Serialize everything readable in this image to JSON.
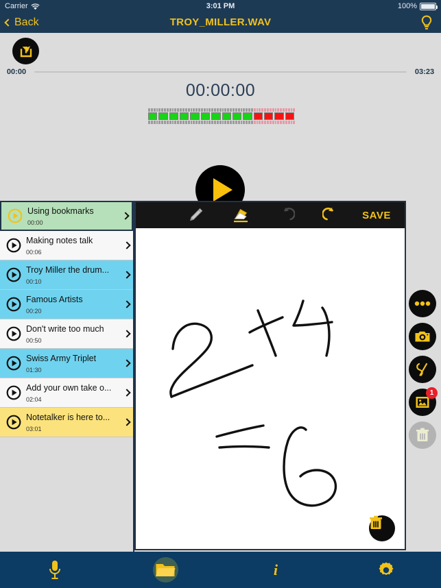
{
  "status_bar": {
    "carrier": "Carrier",
    "wifi_icon": "wifi-icon",
    "time": "3:01 PM",
    "battery_percent": "100%",
    "battery_icon": "battery-icon"
  },
  "nav_bar": {
    "back_label": "Back",
    "back_icon": "chevron-left-icon",
    "title": "TROY_MILLER.WAV",
    "bulb_icon": "lightbulb-icon"
  },
  "player": {
    "share_icon": "share-export-icon",
    "elapsed": "00:00",
    "duration": "03:23",
    "current_time": "00:00:00",
    "play_icon": "play-icon",
    "stop_icon": "stop-icon",
    "bookmark_icon": "bookmark-book-icon",
    "vu_meter": {
      "green_bars": 10,
      "red_bars": 4,
      "green_color": "#18d318",
      "red_color": "#f51414"
    }
  },
  "bookmarks": [
    {
      "title": "Using bookmarks",
      "time": "00:00",
      "color": "#b6e0b9",
      "selected": true,
      "icon": "play-circle-icon"
    },
    {
      "title": "Making notes talk",
      "time": "00:06",
      "color": "#f7f7f7",
      "selected": false,
      "icon": "play-circle-icon"
    },
    {
      "title": "Troy Miller the drum...",
      "time": "00:10",
      "color": "#6fd3ef",
      "selected": false,
      "icon": "play-circle-icon"
    },
    {
      "title": "Famous Artists",
      "time": "00:20",
      "color": "#6fd3ef",
      "selected": false,
      "icon": "play-circle-icon"
    },
    {
      "title": "Don't write too much",
      "time": "00:50",
      "color": "#f7f7f7",
      "selected": false,
      "icon": "play-circle-icon"
    },
    {
      "title": "Swiss Army Triplet",
      "time": "01:30",
      "color": "#6fd3ef",
      "selected": false,
      "icon": "play-circle-icon"
    },
    {
      "title": "Add your own take o...",
      "time": "02:04",
      "color": "#f7f7f7",
      "selected": false,
      "icon": "play-circle-icon"
    },
    {
      "title": "Notetalker is here to...",
      "time": "03:01",
      "color": "#fbe27c",
      "selected": false,
      "icon": "play-circle-icon"
    }
  ],
  "draw_toolbar": {
    "pencil_icon": "pencil-icon",
    "eraser_icon": "eraser-icon",
    "undo_icon": "undo-icon",
    "redo_icon": "redo-icon",
    "save_label": "SAVE",
    "active_tool": "eraser"
  },
  "canvas": {
    "content_description": "2 + 4 = 6",
    "trash_icon": "trash-icon"
  },
  "rail": [
    {
      "icon": "more-dots-icon",
      "disabled": false,
      "badge": ""
    },
    {
      "icon": "camera-icon",
      "disabled": false,
      "badge": ""
    },
    {
      "icon": "scribble-icon",
      "disabled": false,
      "badge": ""
    },
    {
      "icon": "photo-icon",
      "disabled": false,
      "badge": "1"
    },
    {
      "icon": "trash-icon",
      "disabled": true,
      "badge": ""
    }
  ],
  "tab_bar": [
    {
      "icon": "microphone-icon",
      "selected": false
    },
    {
      "icon": "folder-icon",
      "selected": true
    },
    {
      "icon": "info-icon",
      "selected": false,
      "label": "i"
    },
    {
      "icon": "gear-icon",
      "selected": false
    }
  ],
  "theme": {
    "accent": "#f2c21a",
    "navy": "#1d3a55",
    "tabbar": "#0c3b63",
    "background": "#dcdcdc"
  }
}
